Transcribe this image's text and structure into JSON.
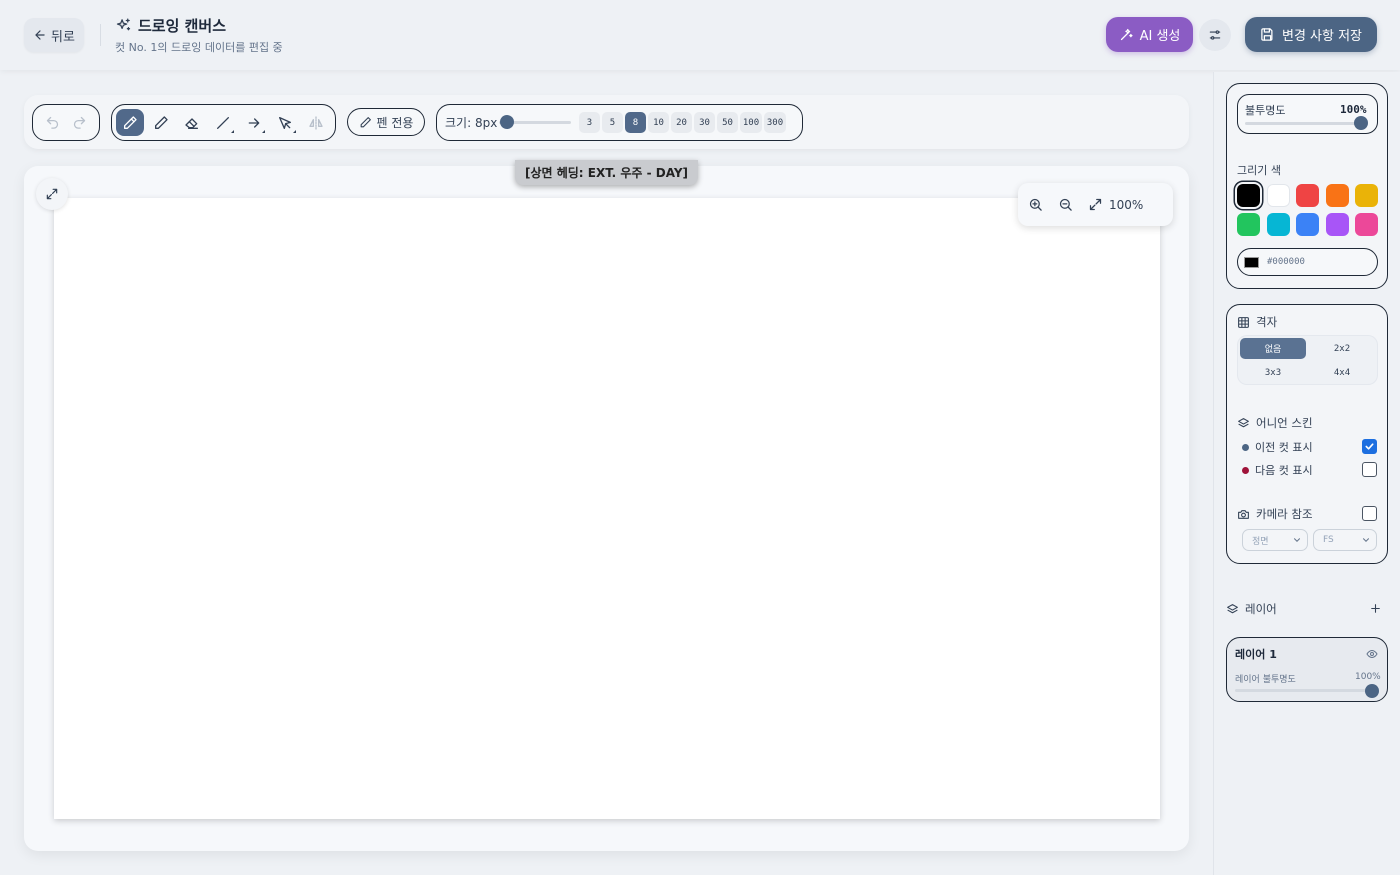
{
  "header": {
    "back_label": "뒤로",
    "title": "드로잉 캔버스",
    "subtitle": "컷 No. 1의 드로잉 데이터를 편집 중",
    "ai_label": "AI 생성",
    "save_label": "변경 사항 저장"
  },
  "toolbar": {
    "pen_only_label": "펜 전용",
    "size_label": "크기: 8px",
    "size_value": 8,
    "sizes": [
      "3",
      "5",
      "8",
      "10",
      "20",
      "30",
      "50",
      "100",
      "300"
    ],
    "active_size": "8",
    "active_tool": "pen"
  },
  "canvas": {
    "scene_label": "[상면 헤딩: EXT. 우주 - DAY]",
    "zoom_label": "100%",
    "background": "#ffffff"
  },
  "panel": {
    "opacity_label": "불투명도",
    "opacity_value": "100%",
    "draw_color_label": "그리기 색",
    "colors": [
      "#000000",
      "#ffffff",
      "#ef4444",
      "#f97316",
      "#eab308",
      "#22c55e",
      "#06b6d4",
      "#3b82f6",
      "#a855f7",
      "#ec4899"
    ],
    "selected_color": "#000000",
    "hex_value": "#000000",
    "grid_title": "격자",
    "grid_options": [
      "없음",
      "2x2",
      "3x3",
      "4x4"
    ],
    "grid_selected": "없음",
    "onion_title": "어니언 스킨",
    "onion_prev_label": "이전 컷 표시",
    "onion_prev_checked": true,
    "onion_next_label": "다음 컷 표시",
    "onion_next_checked": false,
    "camera_title": "카메라 참조",
    "camera_checked": false,
    "camera_angle": "정면",
    "camera_shot": "FS"
  },
  "layers": {
    "title": "레이어",
    "items": [
      {
        "name": "레이어 1",
        "opacity_label": "레이어 불투명도",
        "opacity": "100%"
      }
    ]
  },
  "accent": {
    "primary": "#4c6584",
    "ai": "#8b5cc4",
    "check": "#1d6fe0"
  }
}
